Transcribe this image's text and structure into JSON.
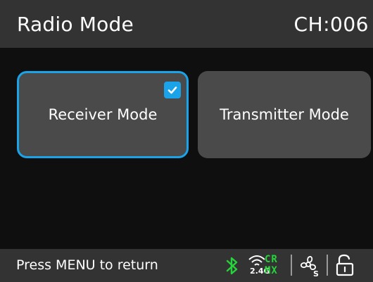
{
  "header": {
    "title": "Radio Mode",
    "channel": "CH:006"
  },
  "modes": [
    {
      "label": "Receiver Mode",
      "selected": true
    },
    {
      "label": "Transmitter Mode",
      "selected": false
    }
  ],
  "footer": {
    "hint": "Press MENU to return",
    "status": {
      "bluetooth_icon": "bluetooth-icon",
      "wireless_band": "2.4G",
      "crmx_line1": "CR",
      "crmx_line2": "MX",
      "fan_icon": "fan-icon",
      "lock_icon": "unlock-icon"
    }
  },
  "colors": {
    "accent": "#1aa3e8",
    "status_green": "#27d33a",
    "bar_bg": "#333333",
    "button_bg": "#4a4a4a",
    "screen_bg": "#0f0f0f"
  }
}
